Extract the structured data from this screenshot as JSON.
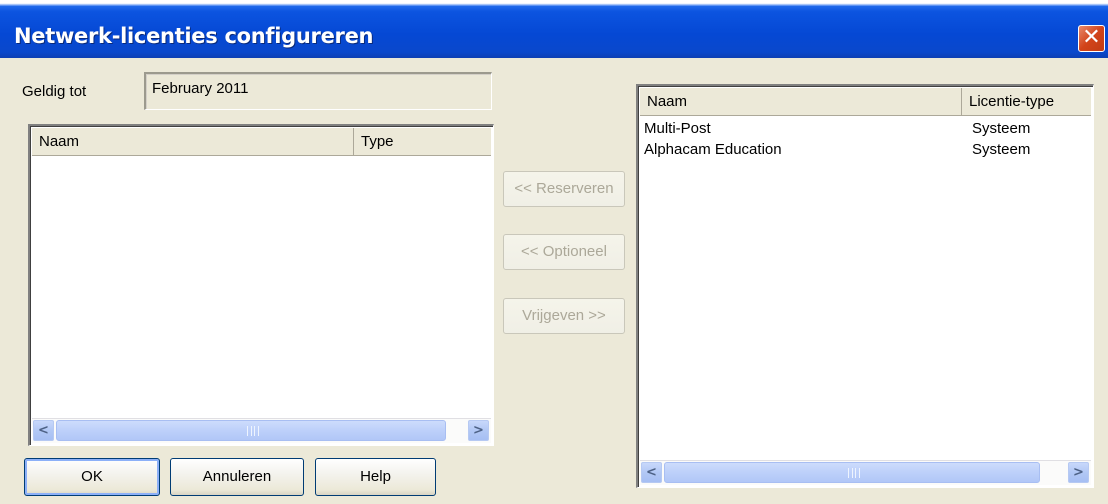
{
  "window": {
    "title": "Netwerk-licenties configureren",
    "close_glyph": "✕"
  },
  "valid_until": {
    "label": "Geldig tot",
    "value": "February 2011"
  },
  "left_list": {
    "columns": [
      "Naam",
      "Type"
    ],
    "rows": []
  },
  "middle_buttons": {
    "reserve": "<< Reserveren",
    "optional": "<< Optioneel",
    "release": "Vrijgeven >>"
  },
  "right_list": {
    "columns": [
      "Naam",
      "Licentie-type"
    ],
    "rows": [
      {
        "name": "Multi-Post",
        "type": "Systeem"
      },
      {
        "name": "Alphacam Education",
        "type": "Systeem"
      }
    ]
  },
  "scrollbar": {
    "left_arrow": "<",
    "right_arrow": ">"
  },
  "footer": {
    "ok": "OK",
    "cancel": "Annuleren",
    "help": "Help"
  },
  "colors": {
    "titlebar": "#0548d4",
    "close_button": "#d2441a",
    "dialog_bg": "#ece9d8"
  },
  "icons": [
    "close-icon",
    "scroll-left-arrow-icon",
    "scroll-right-arrow-icon",
    "scroll-thumb-grip-icon"
  ]
}
